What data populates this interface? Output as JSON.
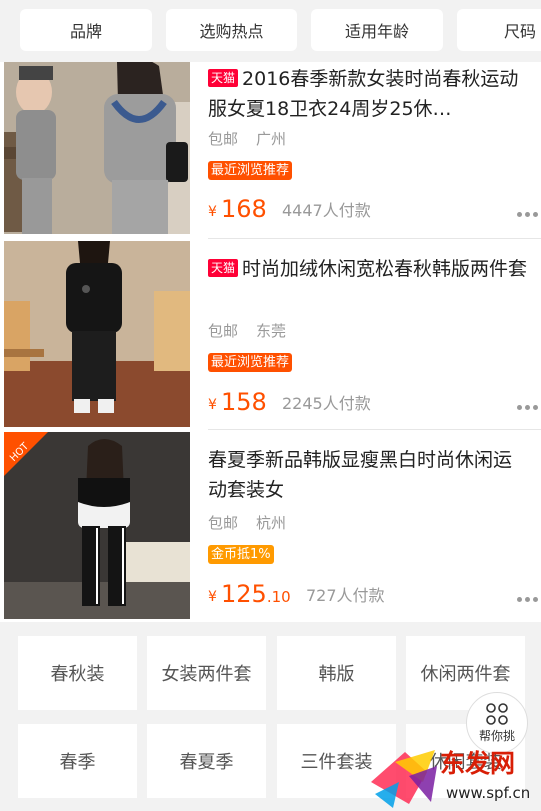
{
  "filters": [
    "品牌",
    "选购热点",
    "适用年龄",
    "尺码"
  ],
  "products": [
    {
      "tmall_badge": "天猫",
      "title": "2016春季新款女装时尚春秋运动服女夏18卫衣24周岁25休…",
      "shipping": "包邮",
      "location": "广州",
      "tag": "最近浏览推荐",
      "currency": "¥",
      "price": "168",
      "price_decimal": "",
      "sold": "4447人付款"
    },
    {
      "tmall_badge": "天猫",
      "title": "时尚加绒休闲宽松春秋韩版两件套",
      "shipping": "包邮",
      "location": "东莞",
      "tag": "最近浏览推荐",
      "currency": "¥",
      "price": "158",
      "price_decimal": "",
      "sold": "2245人付款"
    },
    {
      "tmall_badge": "",
      "hot_label": "HOT",
      "title": "春夏季新品韩版显瘦黑白时尚休闲运动套装女",
      "shipping": "包邮",
      "location": "杭州",
      "tag": "金币抵1%",
      "currency": "¥",
      "price": "125",
      "price_decimal": ".10",
      "sold": "727人付款"
    }
  ],
  "keywords": [
    "春秋装",
    "女装两件套",
    "韩版",
    "休闲两件套",
    "春季",
    "春夏季",
    "三件套装",
    "休闲套装"
  ],
  "helper": {
    "label": "帮你挑",
    "icon": "grid-dots-icon"
  },
  "watermark": {
    "text": "东发网",
    "url": "www.spf.cn"
  },
  "colors": {
    "accent": "#ff5000",
    "tmall": "#ff0036",
    "gold_tag": "#ff9a00",
    "watermark": "#d81e06"
  }
}
